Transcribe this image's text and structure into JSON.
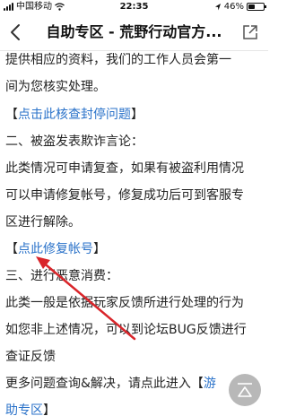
{
  "status_bar": {
    "carrier": "中国移动",
    "time": "22:35",
    "battery_text": "46%",
    "battery_level": 0.46
  },
  "nav": {
    "title": "自助专区 - 荒野行动官方..."
  },
  "content": {
    "p1_line1": "提供相应的资料，我们的工作人员会第一",
    "p1_line2": "间为您核实处理。",
    "link1_open": "【",
    "link1_text": "点击此核查封停问题",
    "link1_close": "】",
    "h2": "二、被盗发表欺诈言论：",
    "p2_line1": "此类情况可申请复查，如果有被盗利用情况",
    "p2_line2": "可以申请修复帐号，修复成功后可到客服专",
    "p2_line3": "区进行解除。",
    "link2_open": "【",
    "link2_text": "点此修复帐号",
    "link2_close": "】",
    "h3": "三、进行恶意消费：",
    "p3_line1": "此类一般是依据玩家反馈所进行处理的行为",
    "p3_line2": "如您非上述情况，可以到论坛BUG反馈进行",
    "p3_line3": "查证反馈",
    "p4_line1_text": "更多问题查询&解决，请点此进入【",
    "p4_line1_link": "游",
    "p4_line2_link": "助专区",
    "p4_line2_close": "】"
  },
  "colors": {
    "link": "#2a72c9",
    "arrow": "#d9252a"
  },
  "icons": {
    "back": "chevron-left-icon",
    "share": "share-icon",
    "top": "back-to-top-icon"
  }
}
